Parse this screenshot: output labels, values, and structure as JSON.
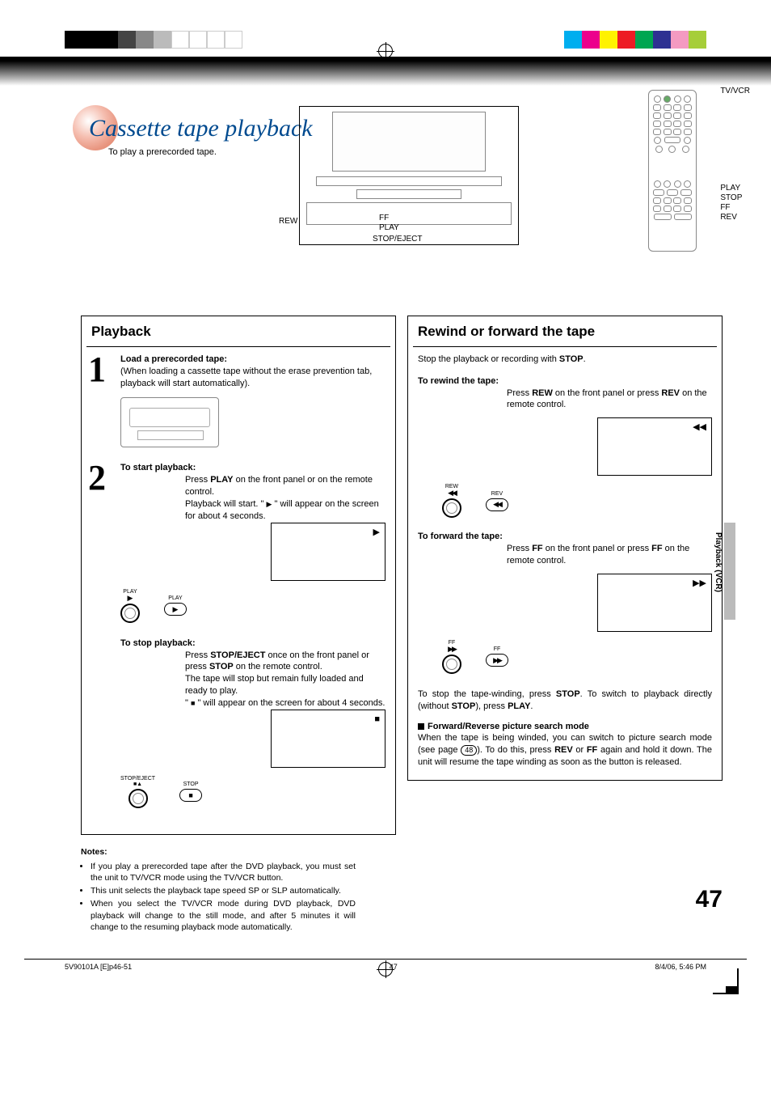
{
  "header": {
    "title": "Cassette tape playback",
    "subtitle": "To play a prerecorded tape."
  },
  "vcr_labels": {
    "rew": "REW",
    "ff": "FF",
    "play": "PLAY",
    "stop_eject": "STOP/EJECT"
  },
  "remote_labels": {
    "tvvcr": "TV/VCR",
    "play": "PLAY",
    "stop": "STOP",
    "ff": "FF",
    "rev": "REV"
  },
  "left_panel": {
    "title": "Playback",
    "step1": {
      "num": "1",
      "heading": "Load a prerecorded tape:",
      "body": "(When loading a cassette tape without the erase prevention tab, playback will start automatically)."
    },
    "step2": {
      "num": "2",
      "heading": "To start playback:",
      "body1": "Press ",
      "body1b": "PLAY",
      "body1c": " on the front panel or on the remote control.",
      "body2a": "Playback will start. \" ",
      "body2b": " \" will appear on the screen for about 4 seconds.",
      "panel_btn_label": "PLAY",
      "remote_btn_label": "PLAY"
    },
    "stop": {
      "heading": "To stop playback:",
      "l1a": "Press ",
      "l1b": "STOP/EJECT",
      "l1c": " once on the front panel or press ",
      "l1d": "STOP",
      "l1e": " on the remote control.",
      "l2": "The tape will stop but remain fully loaded and ready to play.",
      "l3a": "\" ",
      "l3b": " \" will appear on the screen for about 4 seconds.",
      "panel_btn_label": "STOP/EJECT",
      "remote_btn_label": "STOP"
    }
  },
  "right_panel": {
    "title": "Rewind or forward the tape",
    "intro_a": "Stop the playback or recording with ",
    "intro_b": "STOP",
    "intro_c": ".",
    "rewind": {
      "heading": "To rewind the tape:",
      "l1a": "Press ",
      "l1b": "REW",
      "l1c": " on the front panel or press ",
      "l1d": "REV",
      "l1e": " on the remote control.",
      "panel_btn_label": "REW",
      "remote_btn_label": "REV"
    },
    "forward": {
      "heading": "To forward the tape:",
      "l1a": "Press ",
      "l1b": "FF",
      "l1c": " on the front panel or press ",
      "l1d": "FF",
      "l1e": " on the remote control.",
      "panel_btn_label": "FF",
      "remote_btn_label": "FF"
    },
    "tail1a": "To stop the tape-winding, press ",
    "tail1b": "STOP",
    "tail1c": ". To switch to playback directly (without ",
    "tail1d": "STOP",
    "tail1e": "), press ",
    "tail1f": "PLAY",
    "tail1g": ".",
    "mode_heading": "Forward/Reverse picture search mode",
    "mode_a": "When the tape is being winded, you can switch to picture search mode (see page ",
    "mode_page": "48",
    "mode_b": "). To do this, press ",
    "mode_c": "REV",
    "mode_d": " or ",
    "mode_e": "FF",
    "mode_f": " again and hold it down. The unit will resume the tape winding as soon as the button is released."
  },
  "notes": {
    "heading": "Notes:",
    "n1": "If you play a prerecorded tape after the DVD playback, you must set the unit to TV/VCR mode using the TV/VCR button.",
    "n2": "This unit selects the playback tape speed SP or SLP automatically.",
    "n3": "When you select the TV/VCR mode during DVD playback, DVD playback will change to the still mode, and after 5 minutes it will change to the resuming playback mode automatically."
  },
  "side_tab": "Playback (VCR)",
  "page_number": "47",
  "footer": {
    "left": "5V90101A [E]p46-51",
    "mid": "47",
    "right": "8/4/06, 5:46 PM"
  }
}
